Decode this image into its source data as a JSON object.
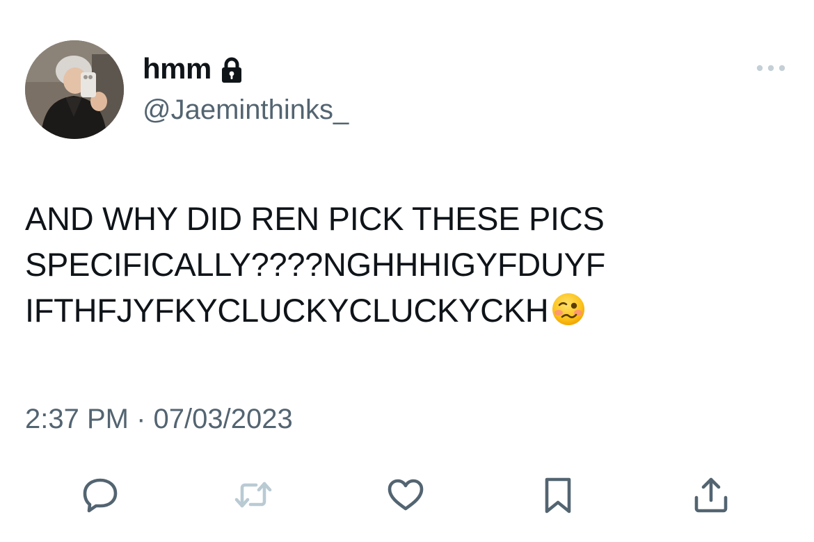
{
  "author": {
    "display_name": "hmm",
    "handle": "@Jaeminthinks_",
    "protected_icon": "lock-icon",
    "avatar_icon": "profile-avatar"
  },
  "tweet": {
    "text_lines": [
      "AND WHY DID REN PICK THESE PICS",
      "SPECIFICALLY????NGHHHIGYFDUYF",
      "IFTHFJYFKYCLUCKYCLUCKYCKH"
    ],
    "trailing_emoji": "woozy-face-emoji",
    "timestamp": "2:37 PM · 07/03/2023"
  },
  "actions": {
    "more": "more-options-icon",
    "reply": "reply-icon",
    "retweet": "retweet-icon",
    "like": "heart-icon",
    "bookmark": "bookmark-icon",
    "share": "share-icon"
  },
  "colors": {
    "text": "#0f1419",
    "secondary": "#536471",
    "action_icon": "#536471",
    "retweet_disabled": "#b9cad3",
    "more_icon": "#c4cfd6"
  }
}
